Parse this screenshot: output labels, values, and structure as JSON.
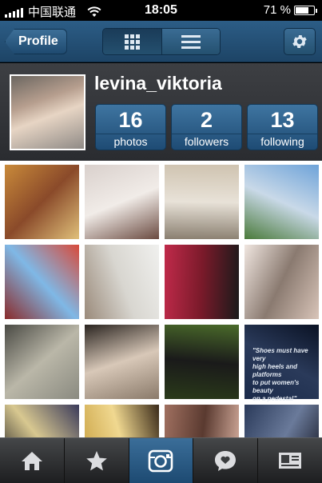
{
  "status_bar": {
    "carrier": "中国联通",
    "time": "18:05",
    "battery_percent": "71 %",
    "battery_level": 0.71
  },
  "nav": {
    "back_label": "Profile",
    "view_modes": [
      {
        "icon": "grid-view-icon",
        "active": true
      },
      {
        "icon": "list-view-icon",
        "active": false
      }
    ],
    "settings_icon": "gear-icon"
  },
  "profile": {
    "username": "levina_viktoria",
    "stats": [
      {
        "count": "16",
        "label": "photos"
      },
      {
        "count": "2",
        "label": "followers"
      },
      {
        "count": "13",
        "label": "following"
      }
    ]
  },
  "photos": [
    {
      "subject": "supermarket shelves",
      "colors": [
        "#c98a3a",
        "#e0c07a",
        "#8a4a2a"
      ]
    },
    {
      "subject": "girl with sunglasses",
      "colors": [
        "#d9d0cc",
        "#6a4a40",
        "#f1ece8"
      ]
    },
    {
      "subject": "louvre pyramid",
      "colors": [
        "#cfc3b0",
        "#8a7f70",
        "#e8e2d8"
      ]
    },
    {
      "subject": "la geode sphere",
      "colors": [
        "#6ea3d9",
        "#4a7a3a",
        "#c9d9e8"
      ]
    },
    {
      "subject": "moulin rouge",
      "colors": [
        "#d94a3a",
        "#8a2a2a",
        "#7fb8e6"
      ]
    },
    {
      "subject": "eiffel tower",
      "colors": [
        "#f0f0ee",
        "#9a8a7a",
        "#d8d6d0"
      ]
    },
    {
      "subject": "red candy apple",
      "colors": [
        "#1a1a1a",
        "#c02a4a",
        "#7a1a2a"
      ]
    },
    {
      "subject": "woman lying down",
      "colors": [
        "#d8c4b8",
        "#f0e6e0",
        "#8a7a70"
      ]
    },
    {
      "subject": "girl on rock",
      "colors": [
        "#8a8a80",
        "#4a4a44",
        "#bab7a8"
      ]
    },
    {
      "subject": "beach with people",
      "colors": [
        "#8a7a6a",
        "#2a2420",
        "#d8c8b8"
      ]
    },
    {
      "subject": "wrist watch",
      "colors": [
        "#2a3a1a",
        "#4a6a2a",
        "#1a1a1a"
      ]
    },
    {
      "subject": "shoes quote card",
      "colors": [
        "#1a2a4a",
        "#0a1224",
        "#2a3a5a"
      ],
      "quote_lines": [
        "\"Shoes must have very",
        "high heels and platforms",
        "to put women's beauty",
        "on a pedesta!\""
      ]
    },
    {
      "subject": "eiffel tower night",
      "colors": [
        "#0a0a14",
        "#3a3a5a",
        "#d8c890"
      ]
    },
    {
      "subject": "woman in yellow room",
      "colors": [
        "#c8a040",
        "#3a2a1a",
        "#f0d890"
      ]
    },
    {
      "subject": "woman portrait",
      "colors": [
        "#a07060",
        "#d8b0a0",
        "#5a3a30"
      ]
    },
    {
      "subject": "city skyline",
      "colors": [
        "#2a3a5a",
        "#0a0a14",
        "#6a7a9a"
      ]
    }
  ],
  "tabs": [
    {
      "name": "home-icon",
      "active": false
    },
    {
      "name": "star-icon",
      "active": false
    },
    {
      "name": "camera-icon",
      "active": true
    },
    {
      "name": "news-bubble-icon",
      "active": false
    },
    {
      "name": "profile-card-icon",
      "active": false
    }
  ]
}
